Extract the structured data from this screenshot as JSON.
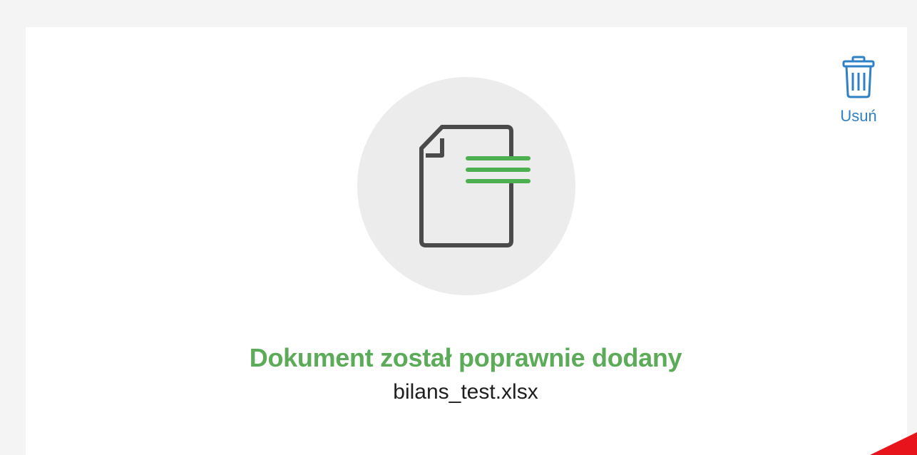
{
  "upload": {
    "delete_label": "Usuń",
    "success_message": "Dokument został poprawnie dodany",
    "file_name": "bilans_test.xlsx"
  },
  "icons": {
    "delete": "trash-icon",
    "document": "document-icon"
  },
  "colors": {
    "success": "#5cab58",
    "link": "#2f80c4",
    "icon_outline": "#4a4a4a",
    "icon_lines": "#4caf50",
    "accent": "#e8141c"
  }
}
